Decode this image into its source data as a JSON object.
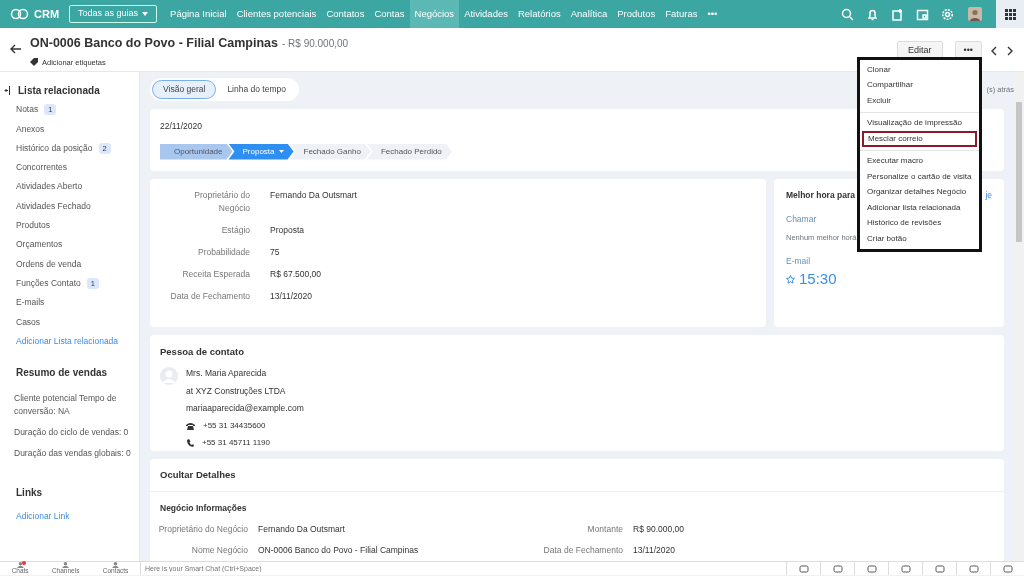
{
  "app": {
    "logo": "CRM",
    "all_tabs": "Todas as guias",
    "more": "•••",
    "tabs": [
      {
        "label": "Página Inicial",
        "selected": false
      },
      {
        "label": "Clientes potenciais",
        "selected": false
      },
      {
        "label": "Contatos",
        "selected": false
      },
      {
        "label": "Contas",
        "selected": false
      },
      {
        "label": "Negócios",
        "selected": true
      },
      {
        "label": "Atividades",
        "selected": false
      },
      {
        "label": "Relatórios",
        "selected": false
      },
      {
        "label": "Analítica",
        "selected": false
      },
      {
        "label": "Produtos",
        "selected": false
      },
      {
        "label": "Faturas",
        "selected": false
      }
    ]
  },
  "record": {
    "title": "ON-0006 Banco do Povo - Filial Campinas",
    "amount": "- R$ 90.000,00",
    "tags_link": "Adicionar etiquetas",
    "edit": "Editar",
    "more": "•••"
  },
  "sidebar": {
    "related_title": "Lista relacionada",
    "related": [
      {
        "label": "Notas",
        "count": "1"
      },
      {
        "label": "Anexos"
      },
      {
        "label": "Histórico da posição",
        "count": "2"
      },
      {
        "label": "Concorrentes"
      },
      {
        "label": "Atividades Aberto"
      },
      {
        "label": "Atividades Fechado"
      },
      {
        "label": "Produtos"
      },
      {
        "label": "Orçamentos"
      },
      {
        "label": "Ordens de venda"
      },
      {
        "label": "Funções Contato",
        "count": "1"
      },
      {
        "label": "E-mails"
      },
      {
        "label": "Casos"
      }
    ],
    "add_related": "Adicionar Lista relacionada",
    "summary_title": "Resumo de vendas",
    "summary": [
      "Cliente potencial Tempo de conversão: NA",
      "Duração do ciclo de vendas: 0",
      "Duração das vendas globais: 0"
    ],
    "links_title": "Links",
    "add_link": "Adicionar Link"
  },
  "view_tabs": [
    {
      "label": "Visão geral",
      "selected": true
    },
    {
      "label": "Linha do tempo",
      "selected": false
    }
  ],
  "updated": "(s) atrás",
  "stage_card": {
    "date": "22/11/2020",
    "stages": [
      {
        "label": "Oportunidade",
        "kind": "done"
      },
      {
        "label": "Proposta",
        "kind": "current"
      },
      {
        "label": "Fechado Ganho",
        "kind": "todo"
      },
      {
        "label": "Fechado Perdido",
        "kind": "todo"
      }
    ]
  },
  "fields": [
    {
      "label": "Proprietário do Negócio",
      "value": "Fernando Da Outsmart"
    },
    {
      "label": "Estágio",
      "value": "Proposta"
    },
    {
      "label": "Probabilidade",
      "value": "75"
    },
    {
      "label": "Receita Esperada",
      "value": "R$ 67.500,00"
    },
    {
      "label": "Data de Fechamento",
      "value": "13/11/2020"
    }
  ],
  "best_time": {
    "title": "Melhor hora para",
    "link": "je",
    "call_label": "Chamar",
    "call_value": "Nenhum melhor horá",
    "email_label": "E-mail",
    "email_time": "15:30"
  },
  "contact": {
    "title": "Pessoa de contato",
    "name": "Mrs. Maria Aparecida",
    "company": "at XYZ Construções LTDA",
    "email": "mariaaparecida@example.com",
    "phone": "+55 31 34435600",
    "mobile": "+55 31 45711 1190"
  },
  "details": {
    "title": "Ocultar Detalhes",
    "section": "Negócio Informações",
    "rows": [
      {
        "label": "Proprietário do Negócio",
        "value": "Fernando Da Outsmart",
        "label2": "Montante",
        "value2": "R$ 90.000,00"
      },
      {
        "label": "Nome Negócio",
        "value": "ON-0006 Banco do Povo - Filial Campinas",
        "label2": "Data de Fechamento",
        "value2": "13/11/2020"
      }
    ]
  },
  "menu": {
    "groups": [
      [
        {
          "label": "Clonar",
          "highlighted": false
        },
        {
          "label": "Compartilhar",
          "highlighted": false
        },
        {
          "label": "Excluir",
          "highlighted": false
        }
      ],
      [
        {
          "label": "Visualização de impressão",
          "highlighted": false
        },
        {
          "label": "Mesclar correio",
          "highlighted": true
        }
      ],
      [
        {
          "label": "Executar macro",
          "highlighted": false
        },
        {
          "label": "Personalize o cartão de visita",
          "highlighted": false
        },
        {
          "label": "Organizar detalhes Negócio",
          "highlighted": false
        },
        {
          "label": "Adicionar lista relacionada",
          "highlighted": false
        },
        {
          "label": "Histórico de revisões",
          "highlighted": false
        },
        {
          "label": "Criar botão",
          "highlighted": false
        }
      ]
    ]
  },
  "bottom": {
    "tabs": [
      {
        "label": "Chats",
        "unread": true
      },
      {
        "label": "Channels",
        "unread": false
      },
      {
        "label": "Contacts",
        "unread": false
      }
    ],
    "chat_placeholder": "Here is your Smart Chat (Ctrl+Space)"
  }
}
